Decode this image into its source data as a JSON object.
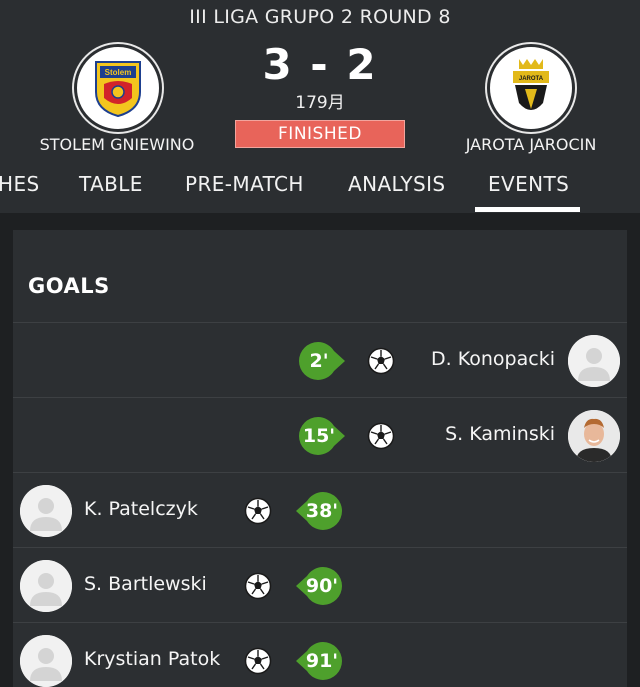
{
  "match": {
    "competition": "III LIGA  GRUPO 2 ROUND 8",
    "home_team": "STOLEM GNIEWINO",
    "away_team": "JAROTA JAROCIN",
    "score": "3 - 2",
    "date": "179月",
    "status": "FINISHED"
  },
  "tabs": [
    {
      "label": "HES"
    },
    {
      "label": "TABLE"
    },
    {
      "label": "PRE-MATCH"
    },
    {
      "label": "ANALYSIS"
    },
    {
      "label": "EVENTS",
      "active": true
    }
  ],
  "goals": {
    "title": "GOALS",
    "events": [
      {
        "side": "away",
        "minute": "2'",
        "player": "D. Konopacki",
        "photo": "placeholder"
      },
      {
        "side": "away",
        "minute": "15'",
        "player": "S. Kaminski",
        "photo": "portrait"
      },
      {
        "side": "home",
        "minute": "38'",
        "player": "K. Patelczyk",
        "photo": "placeholder"
      },
      {
        "side": "home",
        "minute": "90'",
        "player": "S. Bartlewski",
        "photo": "placeholder"
      },
      {
        "side": "home",
        "minute": "91'",
        "player": "Krystian Patok",
        "photo": "placeholder"
      }
    ]
  },
  "colors": {
    "background": "#2b2e31",
    "content_background": "#1e2022",
    "card": "#2c2f32",
    "status_finished": "#e8645a",
    "minute_badge": "#4ea02c",
    "tab_active_underline": "#ffffff"
  },
  "icons": {
    "goal": "soccer-ball-icon",
    "avatar": "player-avatar-icon"
  }
}
